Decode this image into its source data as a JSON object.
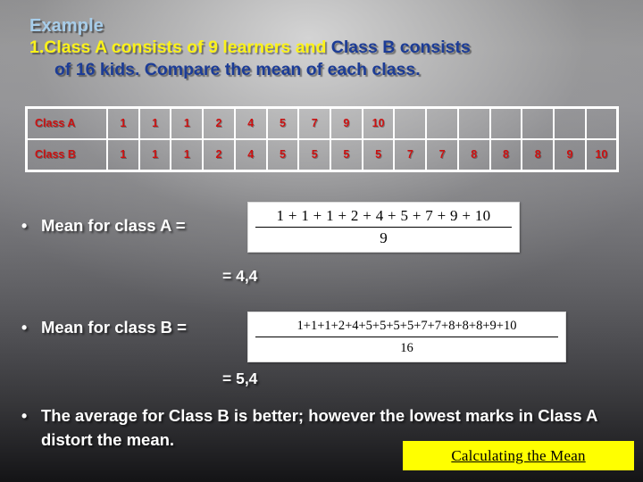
{
  "slide": {
    "title": "Example",
    "question_number": "1.",
    "question_line1_yellow": "Class A consists of 9 learners and ",
    "question_line1_blue": "Class B consists",
    "question_line2_blue": "of 16 kids. Compare the mean of each class."
  },
  "table": {
    "row_a_label": "Class A",
    "row_b_label": "Class B",
    "row_a_values": [
      "1",
      "1",
      "1",
      "2",
      "4",
      "5",
      "7",
      "9",
      "10",
      "",
      "",
      "",
      "",
      "",
      "",
      ""
    ],
    "row_b_values": [
      "1",
      "1",
      "1",
      "2",
      "4",
      "5",
      "5",
      "5",
      "5",
      "7",
      "7",
      "8",
      "8",
      "8",
      "9",
      "10"
    ]
  },
  "bullets": {
    "mean_a_label": "Mean for class A =",
    "mean_b_label": "Mean for class B =",
    "conclusion": "The average for Class B is better; however the lowest marks in Class A distort the mean.",
    "dot": "•"
  },
  "formulas": {
    "mean_a_numerator": "1 + 1 + 1 + 2 + 4 + 5 + 7 + 9 + 10",
    "mean_a_denominator": "9",
    "mean_b_numerator": "1+1+1+2+4+5+5+5+5+7+7+8+8+8+9+10",
    "mean_b_denominator": "16"
  },
  "results": {
    "mean_a_result": "= 4,4",
    "mean_b_result": "= 5,4"
  },
  "footer": {
    "banner_label": "Calculating the Mean"
  },
  "colors": {
    "title_blue_light": "#a7cdea",
    "question_yellow": "#fbf21a",
    "question_blue": "#1c3c96",
    "table_text_red": "#cc1111",
    "bullet_white": "#ffffff",
    "banner_yellow": "#ffff00",
    "banner_text": "#000000"
  }
}
